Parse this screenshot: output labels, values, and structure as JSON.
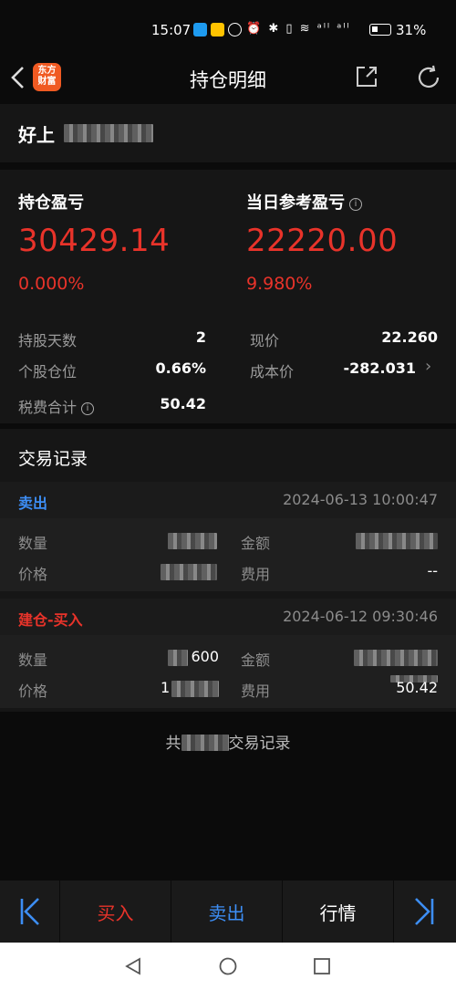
{
  "status_bar": {
    "time": "15:07",
    "battery": "31%",
    "icons": "⏰ ✱ ▯ ≋ ᵃˡˡ ᵃˡˡ"
  },
  "nav": {
    "title": "持仓明细",
    "logo_line1": "东方",
    "logo_line2": "财富"
  },
  "stock": {
    "name": "好上"
  },
  "summary": {
    "position_pl_label": "持仓盈亏",
    "position_pl_value": "30429.14",
    "position_pl_pct": "0.000%",
    "daily_pl_label": "当日参考盈亏",
    "daily_pl_value": "22220.00",
    "daily_pl_pct": "9.980%",
    "rows": {
      "hold_days_label": "持股天数",
      "hold_days_value": "2",
      "price_label": "现价",
      "price_value": "22.260",
      "position_ratio_label": "个股仓位",
      "position_ratio_value": "0.66%",
      "cost_label": "成本价",
      "cost_value": "-282.031",
      "fees_label": "税费合计",
      "fees_value": "50.42"
    }
  },
  "records": {
    "title": "交易记录",
    "items": [
      {
        "type": "卖出",
        "type_color": "#3d8ef5",
        "time": "2024-06-13 10:00:47",
        "qty_label": "数量",
        "amount_label": "金额",
        "price_label": "价格",
        "fee_label": "费用",
        "fee_value": "--"
      },
      {
        "type": "建仓-买入",
        "type_color": "#e8332a",
        "time": "2024-06-12 09:30:46",
        "qty_label": "数量",
        "amount_label": "金额",
        "price_label": "价格",
        "fee_label": "费用",
        "qty_partial": "600",
        "price_partial": "1",
        "fee_partial": "50.42"
      }
    ],
    "footer_prefix": "共",
    "footer_suffix": "交易记录"
  },
  "tabbar": {
    "first": "|<",
    "buy": "买入",
    "sell": "卖出",
    "market": "行情",
    "last": ">|"
  },
  "colors": {
    "red": "#e8332a",
    "blue": "#3d8ef5",
    "bg": "#0b0b0b",
    "panel": "#161616"
  }
}
